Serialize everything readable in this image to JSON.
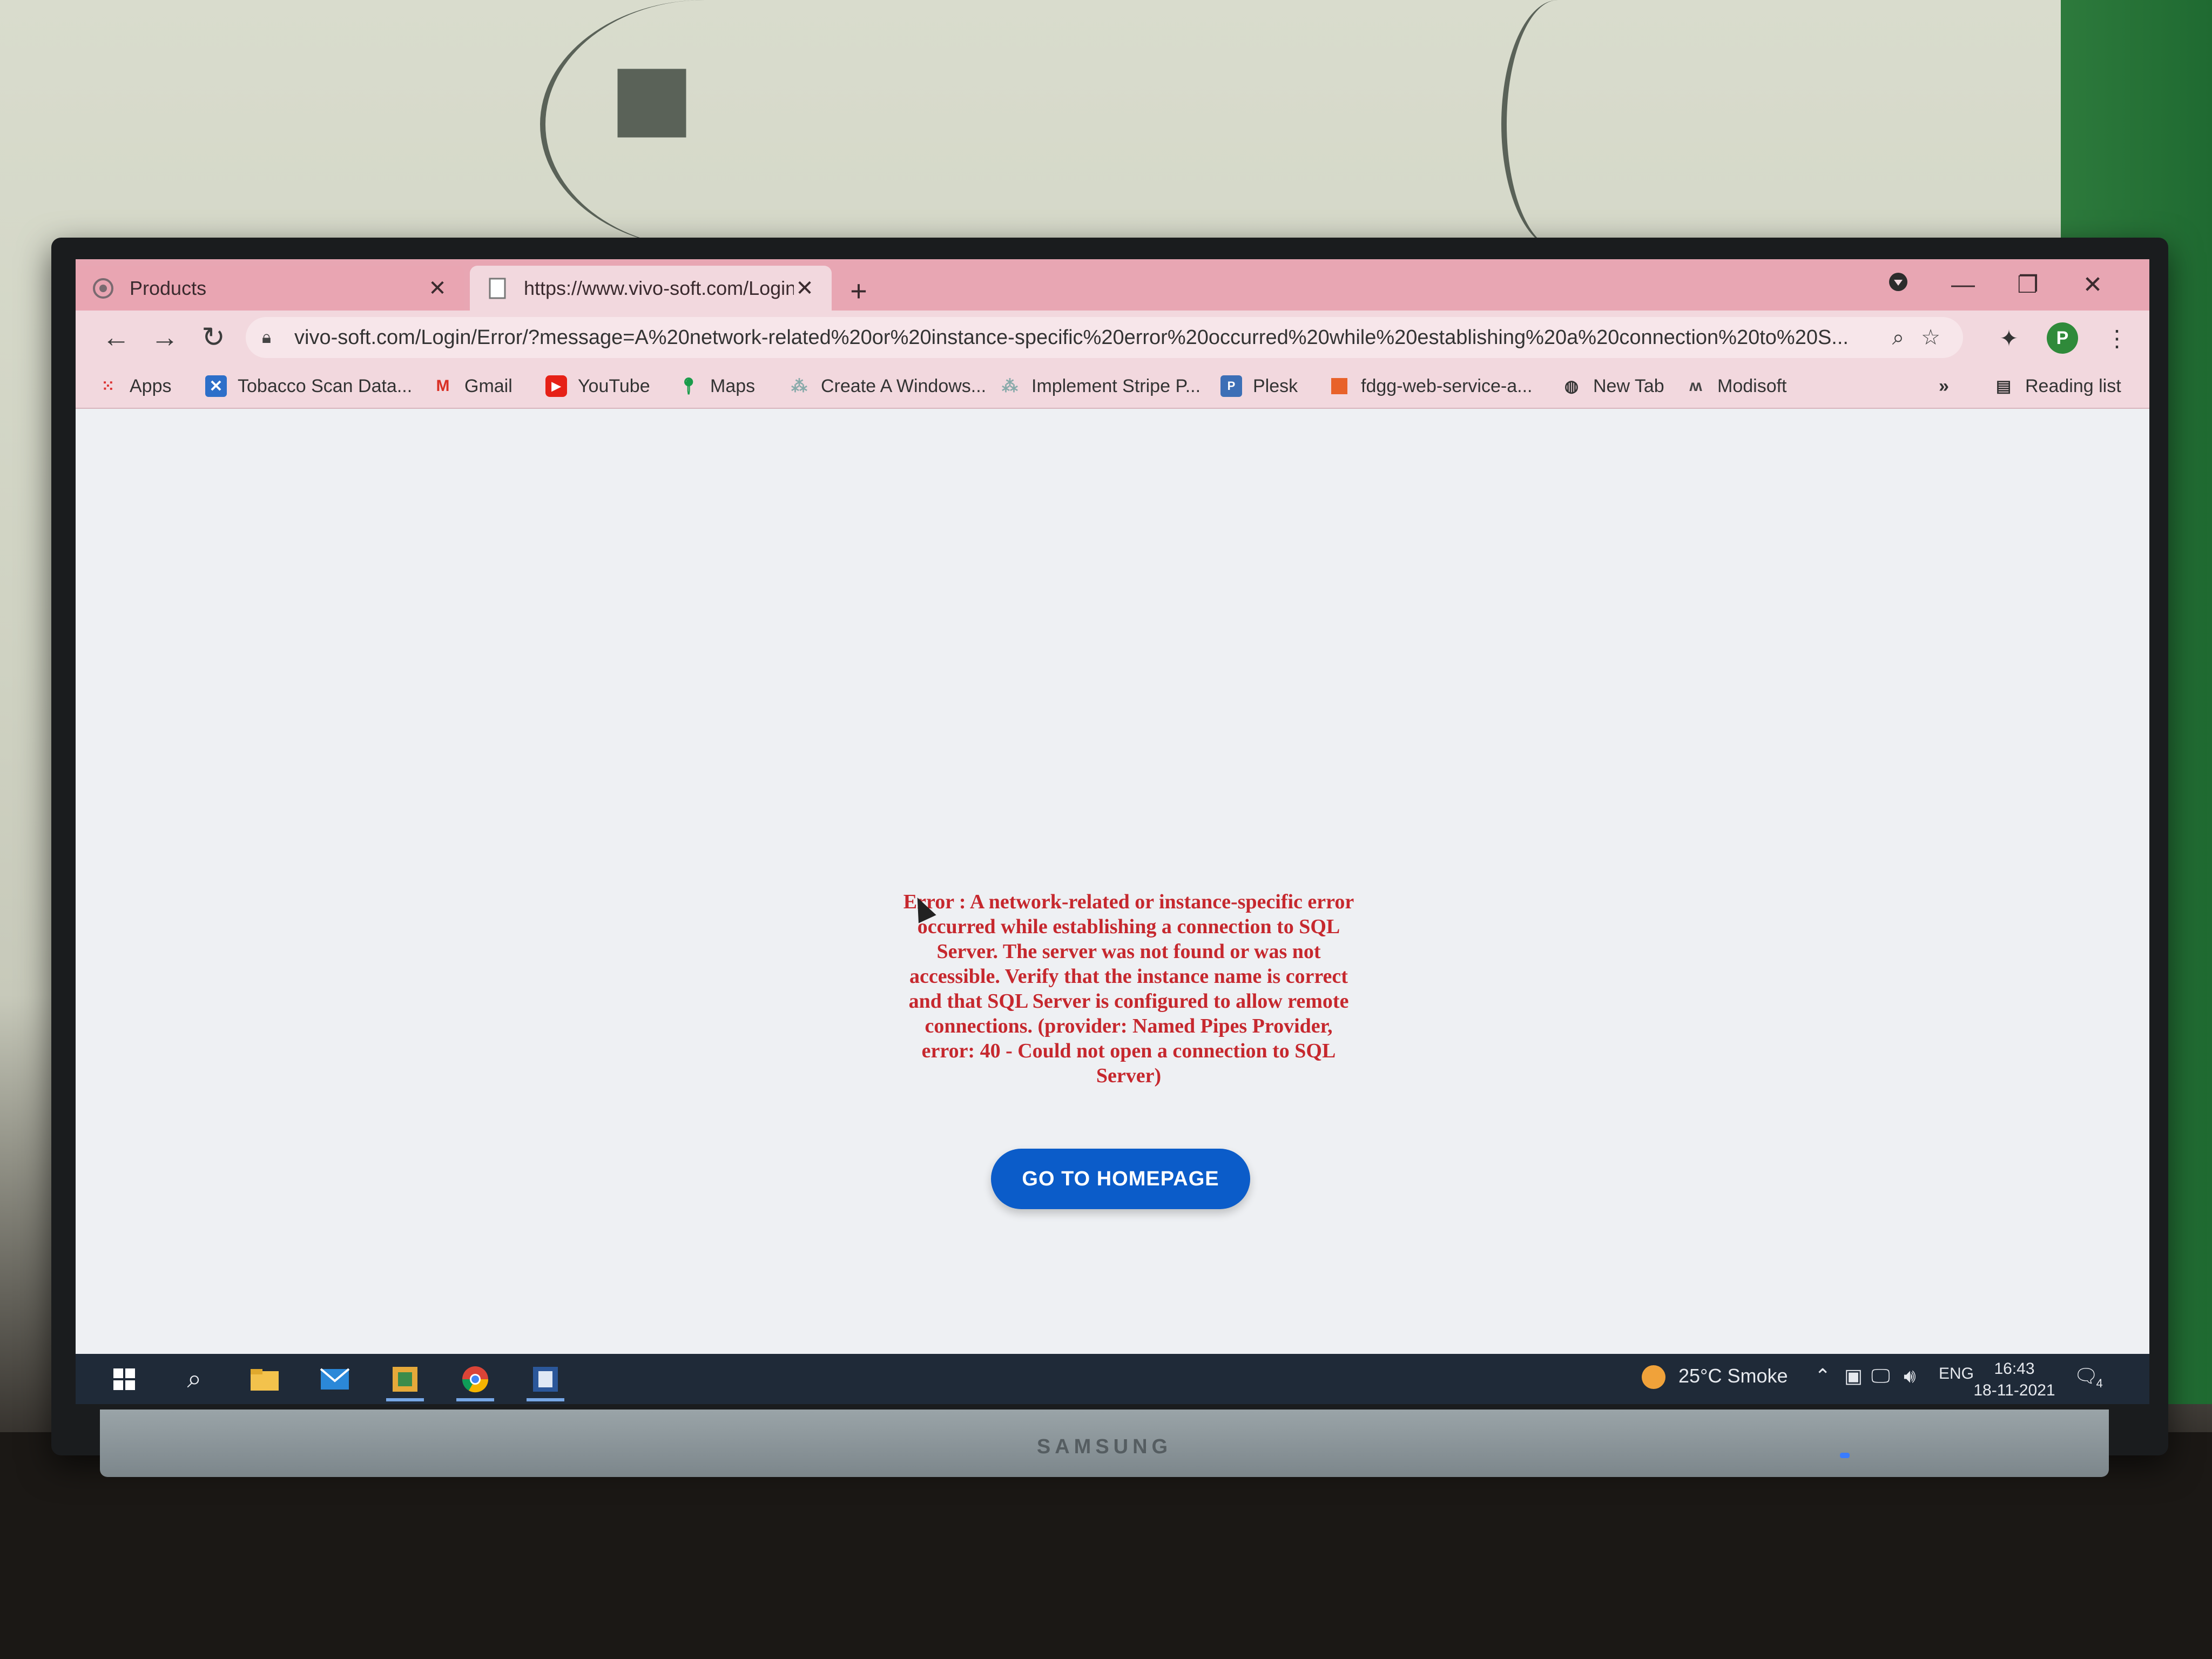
{
  "browser": {
    "tabs": [
      {
        "title": "Products",
        "active": false
      },
      {
        "title": "https://www.vivo-soft.com/Login",
        "active": true
      }
    ],
    "new_tab_icon": "plus-icon",
    "address_bar": {
      "url": "vivo-soft.com/Login/Error/?message=A%20network-related%20or%20instance-specific%20error%20occurred%20while%20establishing%20a%20connection%20to%20S..."
    },
    "profile_initial": "P",
    "bookmarks": [
      {
        "label": "Apps",
        "icon": "apps-grid-icon"
      },
      {
        "label": "Tobacco Scan Data...",
        "icon": "scan-icon"
      },
      {
        "label": "Gmail",
        "icon": "gmail-icon"
      },
      {
        "label": "YouTube",
        "icon": "youtube-icon"
      },
      {
        "label": "Maps",
        "icon": "maps-pin-icon"
      },
      {
        "label": "Create A Windows...",
        "icon": "page-icon"
      },
      {
        "label": "Implement Stripe P...",
        "icon": "page-icon"
      },
      {
        "label": "Plesk",
        "icon": "plesk-icon"
      },
      {
        "label": "fdgg-web-service-a...",
        "icon": "orange-square-icon"
      },
      {
        "label": "New Tab",
        "icon": "globe-icon"
      },
      {
        "label": "Modisoft",
        "icon": "modisoft-icon"
      }
    ],
    "reading_list_label": "Reading list",
    "overflow_label": "»"
  },
  "page": {
    "error_message": "Error : A network-related or instance-specific error occurred while establishing a connection to SQL Server. The server was not found or was not accessible. Verify that the instance name is correct and that SQL Server is configured to allow remote connections. (provider: Named Pipes Provider, error: 40 - Could not open a connection to SQL Server)",
    "home_button_label": "GO TO HOMEPAGE"
  },
  "taskbar": {
    "weather": "25°C  Smoke",
    "language": "ENG",
    "time": "16:43",
    "date": "18-11-2021",
    "notification_count": "4"
  },
  "monitor": {
    "brand": "SAMSUNG"
  },
  "colors": {
    "tab_strip": "#e8a6b3",
    "error_text": "#c6282e",
    "button": "#0b5cc9",
    "taskbar": "#1f2a38"
  }
}
